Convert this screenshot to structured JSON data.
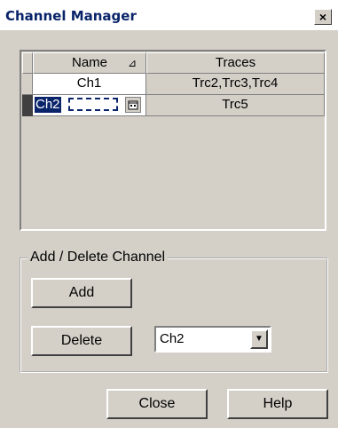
{
  "window": {
    "title": "Channel Manager",
    "close_glyph": "×"
  },
  "table": {
    "columns": [
      {
        "label": "Name",
        "sort_glyph": "⊿"
      },
      {
        "label": "Traces"
      }
    ],
    "rows": [
      {
        "name": "Ch1",
        "traces": "Trc2,Trc3,Trc4"
      },
      {
        "name": "Ch2",
        "traces": "Trc5",
        "editing": true
      }
    ]
  },
  "group": {
    "label": "Add / Delete Channel",
    "add_label": "Add",
    "delete_label": "Delete",
    "channel_select": {
      "value": "Ch2"
    }
  },
  "footer": {
    "close_label": "Close",
    "help_label": "Help"
  },
  "colors": {
    "title_text": "#0a246a",
    "selection": "#0a246a",
    "face": "#d4d0c8"
  }
}
